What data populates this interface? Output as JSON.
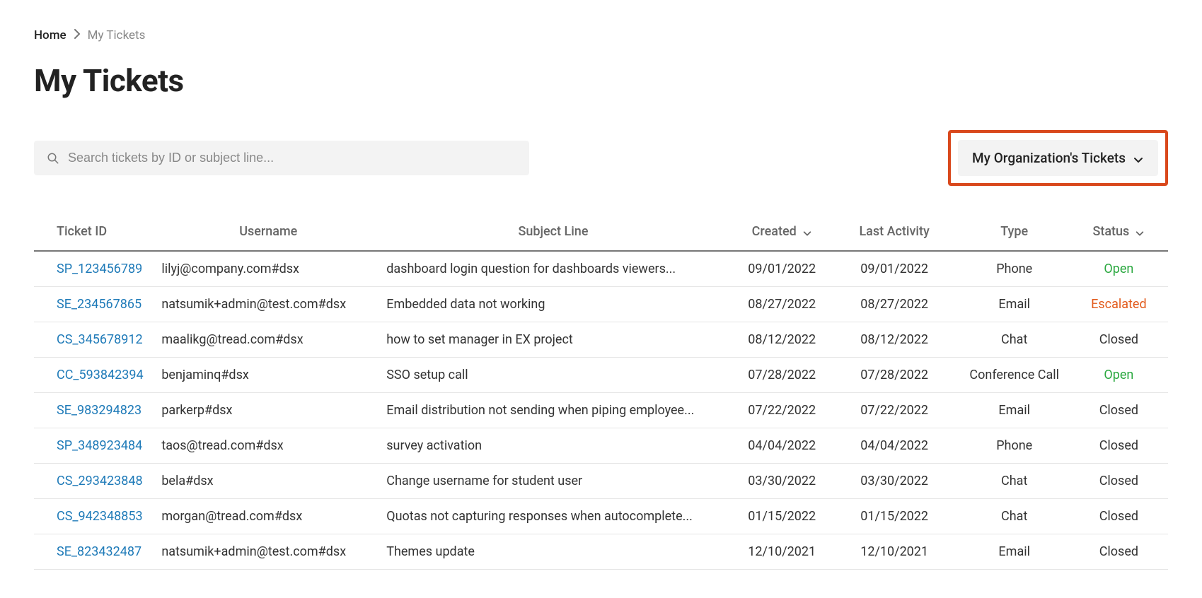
{
  "breadcrumb": {
    "home": "Home",
    "current": "My Tickets"
  },
  "page_title": "My Tickets",
  "search": {
    "placeholder": "Search tickets by ID or subject line..."
  },
  "filter": {
    "label": "My Organization's Tickets"
  },
  "columns": {
    "ticket_id": "Ticket ID",
    "username": "Username",
    "subject": "Subject Line",
    "created": "Created",
    "last_activity": "Last Activity",
    "type": "Type",
    "status": "Status"
  },
  "rows": [
    {
      "id": "SP_123456789",
      "user": "lilyj@company.com#dsx",
      "subject": "dashboard login question for dashboards viewers...",
      "created": "09/01/2022",
      "activity": "09/01/2022",
      "type": "Phone",
      "status": "Open",
      "status_class": "status-open"
    },
    {
      "id": "SE_234567865",
      "user": "natsumik+admin@test.com#dsx",
      "subject": "Embedded data not working",
      "created": "08/27/2022",
      "activity": "08/27/2022",
      "type": "Email",
      "status": "Escalated",
      "status_class": "status-escalated"
    },
    {
      "id": "CS_345678912",
      "user": "maalikg@tread.com#dsx",
      "subject": "how to set manager in EX project",
      "created": "08/12/2022",
      "activity": "08/12/2022",
      "type": "Chat",
      "status": "Closed",
      "status_class": "status-closed"
    },
    {
      "id": "CC_593842394",
      "user": "benjaminq#dsx",
      "subject": "SSO setup call",
      "created": "07/28/2022",
      "activity": "07/28/2022",
      "type": "Conference Call",
      "status": "Open",
      "status_class": "status-open"
    },
    {
      "id": "SE_983294823",
      "user": "parkerp#dsx",
      "subject": "Email distribution not sending when piping employee...",
      "created": "07/22/2022",
      "activity": "07/22/2022",
      "type": "Email",
      "status": "Closed",
      "status_class": "status-closed"
    },
    {
      "id": "SP_348923484",
      "user": "taos@tread.com#dsx",
      "subject": "survey activation",
      "created": "04/04/2022",
      "activity": "04/04/2022",
      "type": "Phone",
      "status": "Closed",
      "status_class": "status-closed"
    },
    {
      "id": "CS_293423848",
      "user": "bela#dsx",
      "subject": "Change username for student user",
      "created": "03/30/2022",
      "activity": "03/30/2022",
      "type": "Chat",
      "status": "Closed",
      "status_class": "status-closed"
    },
    {
      "id": "CS_942348853",
      "user": "morgan@tread.com#dsx",
      "subject": "Quotas not capturing responses when autocomplete...",
      "created": "01/15/2022",
      "activity": "01/15/2022",
      "type": "Chat",
      "status": "Closed",
      "status_class": "status-closed"
    },
    {
      "id": "SE_823432487",
      "user": "natsumik+admin@test.com#dsx",
      "subject": "Themes update",
      "created": "12/10/2021",
      "activity": "12/10/2021",
      "type": "Email",
      "status": "Closed",
      "status_class": "status-closed"
    }
  ]
}
